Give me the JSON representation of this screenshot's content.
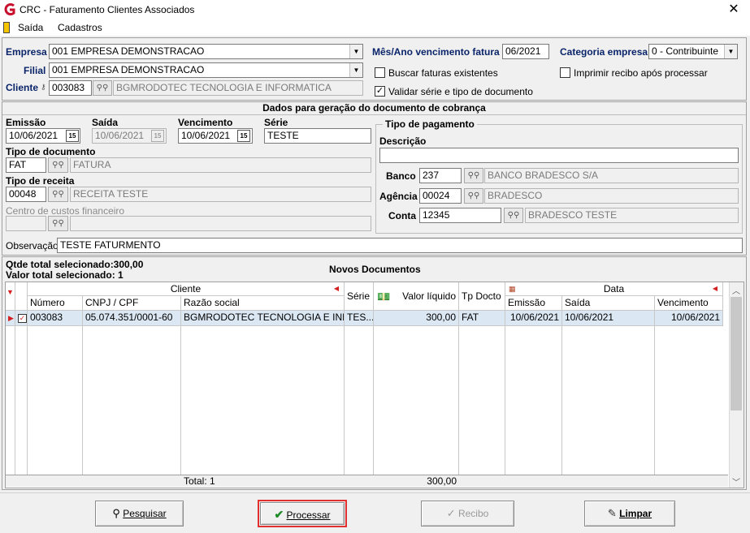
{
  "window": {
    "title": "CRC - Faturamento Clientes Associados",
    "close_label": "✕"
  },
  "menu": {
    "items": [
      "Saída",
      "Cadastros"
    ]
  },
  "top": {
    "empresa_label": "Empresa",
    "empresa_value": "001 EMPRESA DEMONSTRACAO",
    "filial_label": "Filial",
    "filial_value": "001 EMPRESA DEMONSTRACAO",
    "cliente_label": "Cliente",
    "cliente_code": "003083",
    "cliente_name": "BGMRODOTEC TECNOLOGIA E INFORMATICA",
    "mes_ano_label": "Mês/Ano vencimento fatura",
    "mes_ano_value": "06/2021",
    "categoria_label": "Categoria empresa",
    "categoria_value": "0 - Contribuinte",
    "buscar_label": "Buscar faturas existentes",
    "buscar_checked": false,
    "imprimir_label": "Imprimir recibo após processar",
    "imprimir_checked": false,
    "validar_label": "Validar série e tipo de documento",
    "validar_checked": true
  },
  "cobranca": {
    "header": "Dados para geração do documento de cobrança",
    "emissao_label": "Emissão",
    "emissao_value": "10/06/2021",
    "saida_label": "Saída",
    "saida_value": "10/06/2021",
    "vencimento_label": "Vencimento",
    "vencimento_value": "10/06/2021",
    "serie_label": "Série",
    "serie_value": "TESTE",
    "tipo_doc_label": "Tipo de documento",
    "tipo_doc_code": "FAT",
    "tipo_doc_name": "FATURA",
    "tipo_receita_label": "Tipo de receita",
    "tipo_receita_code": "00048",
    "tipo_receita_name": "RECEITA TESTE",
    "centro_custos_label": "Centro de custos financeiro",
    "centro_custos_code": "",
    "centro_custos_name": "",
    "observacao_label": "Observação",
    "observacao_value": "TESTE FATURMENTO",
    "cal_icon_text": "15"
  },
  "pagamento": {
    "group_label": "Tipo de pagamento",
    "descricao_label": "Descrição",
    "descricao_value": "",
    "banco_label": "Banco",
    "banco_code": "237",
    "banco_name": "BANCO BRADESCO S/A",
    "agencia_label": "Agência",
    "agencia_code": "00024",
    "agencia_name": "BRADESCO",
    "conta_label": "Conta",
    "conta_code": "12345",
    "conta_name": "BRADESCO TESTE"
  },
  "novos": {
    "qtde_label": "Qtde total selecionado:300,00",
    "valor_label": "Valor total selecionado: 1",
    "header": "Novos Documentos",
    "group_cliente": "Cliente",
    "group_data": "Data",
    "columns": [
      "Número",
      "CNPJ / CPF",
      "Razão social",
      "Série",
      "Valor líquido",
      "Tp Docto",
      "Emissão",
      "Saída",
      "Vencimento"
    ],
    "rows": [
      {
        "numero": "003083",
        "cnpj": "05.074.351/0001-60",
        "razao": "BGMRODOTEC TECNOLOGIA E INF...",
        "serie": "TES...",
        "valor": "300,00",
        "tp": "FAT",
        "emissao": "10/06/2021",
        "saida": "10/06/2021",
        "vencimento": "10/06/2021",
        "checked": true
      }
    ],
    "footer_total": "Total: 1",
    "footer_valor": "300,00"
  },
  "buttons": {
    "pesquisar": "Pesquisar",
    "processar": "Processar",
    "recibo": "Recibo",
    "limpar": "Limpar"
  },
  "colors": {
    "accent_red": "#d42020",
    "label_blue": "#0a246a",
    "highlight_border": "#e03030"
  }
}
